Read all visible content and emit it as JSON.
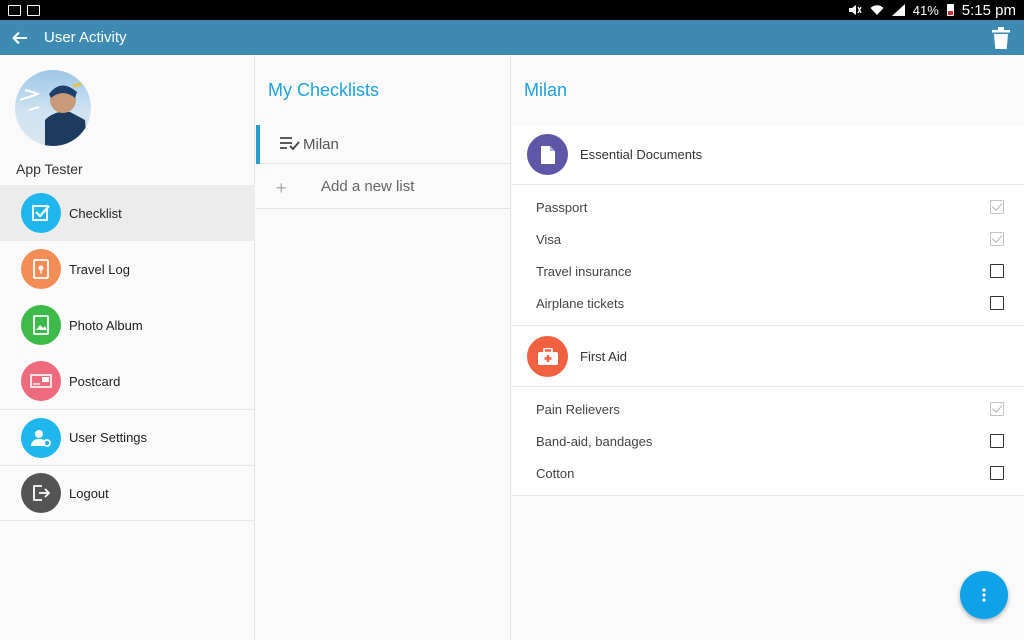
{
  "status_bar": {
    "battery": "41%",
    "time": "5:15 pm"
  },
  "appbar": {
    "title": "User Activity"
  },
  "profile": {
    "name": "App Tester"
  },
  "nav": {
    "items": [
      {
        "label": "Checklist",
        "icon": "checklist-icon",
        "color": "#1fb6ee"
      },
      {
        "label": "Travel Log",
        "icon": "travel-log-icon",
        "color": "#f48c56"
      },
      {
        "label": "Photo Album",
        "icon": "photo-album-icon",
        "color": "#3dba4a"
      },
      {
        "label": "Postcard",
        "icon": "postcard-icon",
        "color": "#ee6b7e"
      },
      {
        "label": "User Settings",
        "icon": "user-settings-icon",
        "color": "#1fb6ee"
      },
      {
        "label": "Logout",
        "icon": "logout-icon",
        "color": "#545454"
      }
    ]
  },
  "checklists": {
    "title": "My Checklists",
    "items": [
      {
        "name": "Milan"
      }
    ],
    "add_label": "Add a new list",
    "add_symbol": "+"
  },
  "detail": {
    "title": "Milan",
    "sections": [
      {
        "label": "Essential Documents",
        "icon": "document-icon",
        "color": "#5e57a8",
        "items": [
          {
            "label": "Passport",
            "checked": true
          },
          {
            "label": "Visa",
            "checked": true
          },
          {
            "label": "Travel insurance",
            "checked": false
          },
          {
            "label": "Airplane tickets",
            "checked": false
          }
        ]
      },
      {
        "label": "First Aid",
        "icon": "first-aid-icon",
        "color": "#f1613f",
        "items": [
          {
            "label": "Pain Relievers",
            "checked": true
          },
          {
            "label": "Band-aid, bandages",
            "checked": false
          },
          {
            "label": "Cotton",
            "checked": false
          }
        ]
      }
    ]
  },
  "colors": {
    "appbar": "#3d8bb3",
    "accent": "#1ea3db",
    "fab": "#0fa2e9"
  }
}
